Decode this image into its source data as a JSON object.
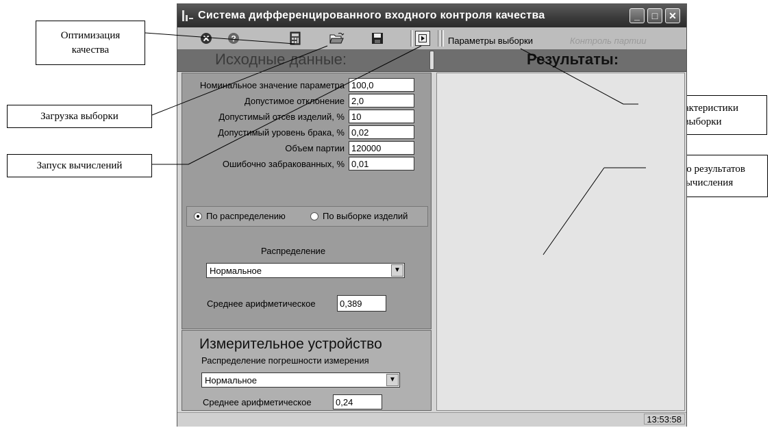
{
  "window": {
    "title": "Система дифференцированного входного контроля качества",
    "minimize_icon": "minimize-icon",
    "maximize_icon": "maximize-icon",
    "close_icon": "close-icon"
  },
  "toolbar": {
    "menu_params": "Параметры выборки",
    "menu_control": "Контроль партии"
  },
  "header": {
    "left": "Исходные данные:",
    "right": "Результаты:"
  },
  "params": [
    {
      "label": "Номинальное значение параметра",
      "value": "100,0"
    },
    {
      "label": "Допустимое отклонение",
      "value": "2,0"
    },
    {
      "label": "Допустимый отсев изделий, %",
      "value": "10"
    },
    {
      "label": "Допустимый уровень брака, %",
      "value": "0,02"
    },
    {
      "label": "Объем партии",
      "value": "120000"
    },
    {
      "label": "Ошибочно забракованных, %",
      "value": "0,01"
    }
  ],
  "mode": {
    "option1": "По распределению",
    "option2": "По выборке изделий",
    "selected": "option1"
  },
  "distribution": {
    "label": "Распределение",
    "value": "Нормальное",
    "mean_label": "Среднее арифметическое",
    "mean_value": "0,389"
  },
  "device": {
    "title": "Измерительное устройство",
    "dist_label": "Распределение погрешности измерения",
    "dist_value": "Нормальное",
    "mean_label": "Среднее арифметическое",
    "mean_value": "0,24"
  },
  "status": {
    "time": "13:53:58"
  },
  "callouts": {
    "optimization": "Оптимизация качества",
    "load_sample": "Загрузка выборки",
    "run_calc": "Запуск вычислений",
    "sample_chars": "Характеристики выборки",
    "results_window": "Окно результатов вычисления"
  }
}
